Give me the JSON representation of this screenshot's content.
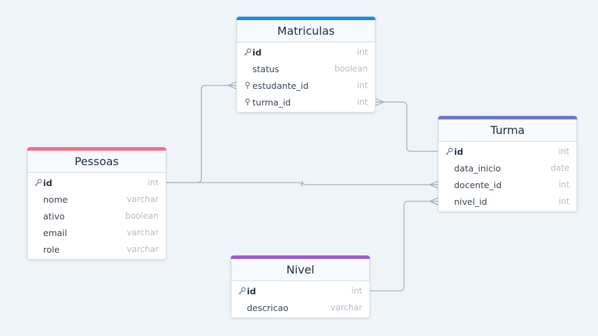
{
  "colors": {
    "background": "#eff4f8",
    "edge": "#9fb1c2",
    "pessoas": "#f76b8a",
    "matriculas": "#1a8fdc",
    "turma": "#6a75c9",
    "nivel": "#9b5bd6"
  },
  "icons": {
    "primary_key": "key-icon",
    "foreign_key": "pin-icon"
  },
  "tables": [
    {
      "id": "matriculas",
      "title": "Matriculas",
      "color": "#1a8fdc",
      "columns": [
        {
          "name": "id",
          "type": "int",
          "key": "pk"
        },
        {
          "name": "status",
          "type": "boolean",
          "key": ""
        },
        {
          "name": "estudante_id",
          "type": "int",
          "key": "fk"
        },
        {
          "name": "turma_id",
          "type": "int",
          "key": "fk"
        }
      ]
    },
    {
      "id": "turma",
      "title": "Turma",
      "color": "#6a75c9",
      "columns": [
        {
          "name": "id",
          "type": "int",
          "key": "pk"
        },
        {
          "name": "data_inicio",
          "type": "date",
          "key": ""
        },
        {
          "name": "docente_id",
          "type": "int",
          "key": ""
        },
        {
          "name": "nivel_id",
          "type": "int",
          "key": ""
        }
      ]
    },
    {
      "id": "pessoas",
      "title": "Pessoas",
      "color": "#f76b8a",
      "columns": [
        {
          "name": "id",
          "type": "int",
          "key": "pk"
        },
        {
          "name": "nome",
          "type": "varchar",
          "key": ""
        },
        {
          "name": "ativo",
          "type": "boolean",
          "key": ""
        },
        {
          "name": "email",
          "type": "varchar",
          "key": ""
        },
        {
          "name": "role",
          "type": "varchar",
          "key": ""
        }
      ]
    },
    {
      "id": "nivel",
      "title": "Nivel",
      "color": "#9b5bd6",
      "columns": [
        {
          "name": "id",
          "type": "int",
          "key": "pk"
        },
        {
          "name": "descricao",
          "type": "varchar",
          "key": ""
        }
      ]
    }
  ],
  "relations": [
    {
      "from_table": "pessoas",
      "from_column": "id",
      "to_table": "matriculas",
      "to_column": "estudante_id",
      "cardinality": "one-to-many"
    },
    {
      "from_table": "turma",
      "from_column": "id",
      "to_table": "matriculas",
      "to_column": "turma_id",
      "cardinality": "one-to-many"
    },
    {
      "from_table": "pessoas",
      "from_column": "id",
      "to_table": "turma",
      "to_column": "docente_id",
      "cardinality": "one-to-many"
    },
    {
      "from_table": "nivel",
      "from_column": "id",
      "to_table": "turma",
      "to_column": "nivel_id",
      "cardinality": "one-to-many"
    }
  ]
}
